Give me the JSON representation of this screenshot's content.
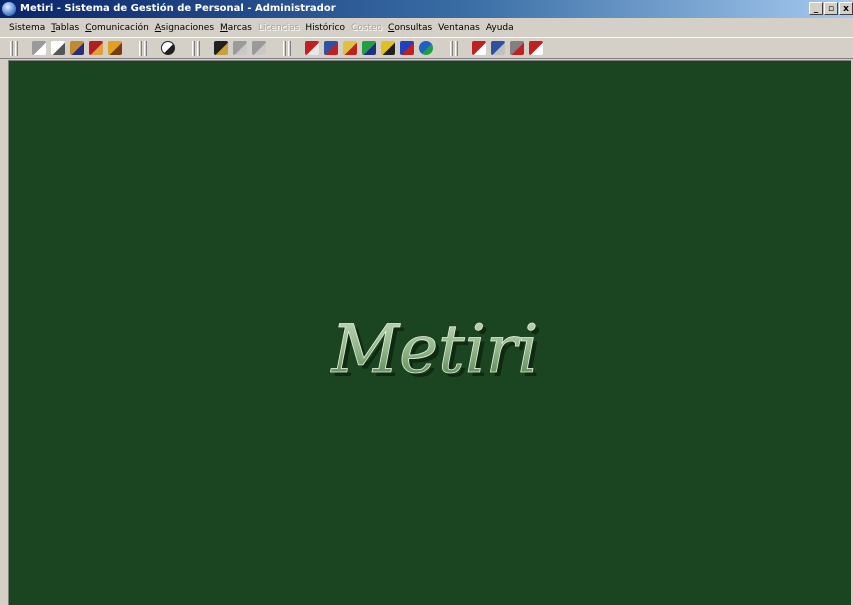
{
  "window": {
    "app_name": "Metiri",
    "title_rest": " - Sistema de Gestión de Personal - Administrador",
    "buttons": {
      "minimize": "_",
      "restore": "▫",
      "close": "x"
    }
  },
  "menu": {
    "items": [
      {
        "mnemonic": "",
        "rest": "Sistema",
        "disabled": false
      },
      {
        "mnemonic": "T",
        "rest": "ablas",
        "disabled": false
      },
      {
        "mnemonic": "C",
        "rest": "omunicación",
        "disabled": false
      },
      {
        "mnemonic": "A",
        "rest": "signaciones",
        "disabled": false
      },
      {
        "mnemonic": "M",
        "rest": "arcas",
        "disabled": false
      },
      {
        "mnemonic": "",
        "rest": "Licencias",
        "disabled": true
      },
      {
        "mnemonic": "",
        "rest": "Histórico",
        "disabled": false
      },
      {
        "mnemonic": "",
        "rest": "Costeo",
        "disabled": true
      },
      {
        "mnemonic": "C",
        "rest": "onsultas",
        "disabled": false
      },
      {
        "mnemonic": "",
        "rest": "Ventanas",
        "disabled": false
      },
      {
        "mnemonic": "",
        "rest": "Ayuda",
        "disabled": false
      }
    ]
  },
  "toolbar": {
    "groups": [
      [
        "printer-icon",
        "document-stack-icon",
        "users-icon",
        "book-icon",
        "person-icon"
      ],
      [
        "clock-icon"
      ],
      [
        "employee-icon",
        "employee-disabled-icon",
        "employee-disabled-icon"
      ],
      [
        "report-icon",
        "people-report-icon",
        "mail-icon",
        "chart-icon",
        "person-report-icon",
        "list-report-icon",
        "globe-icon"
      ],
      [
        "calendar-icon",
        "settings-icon",
        "tools-icon",
        "window-icon"
      ]
    ]
  },
  "workspace": {
    "background": "#1b4520",
    "logo_text": "Metiri"
  }
}
